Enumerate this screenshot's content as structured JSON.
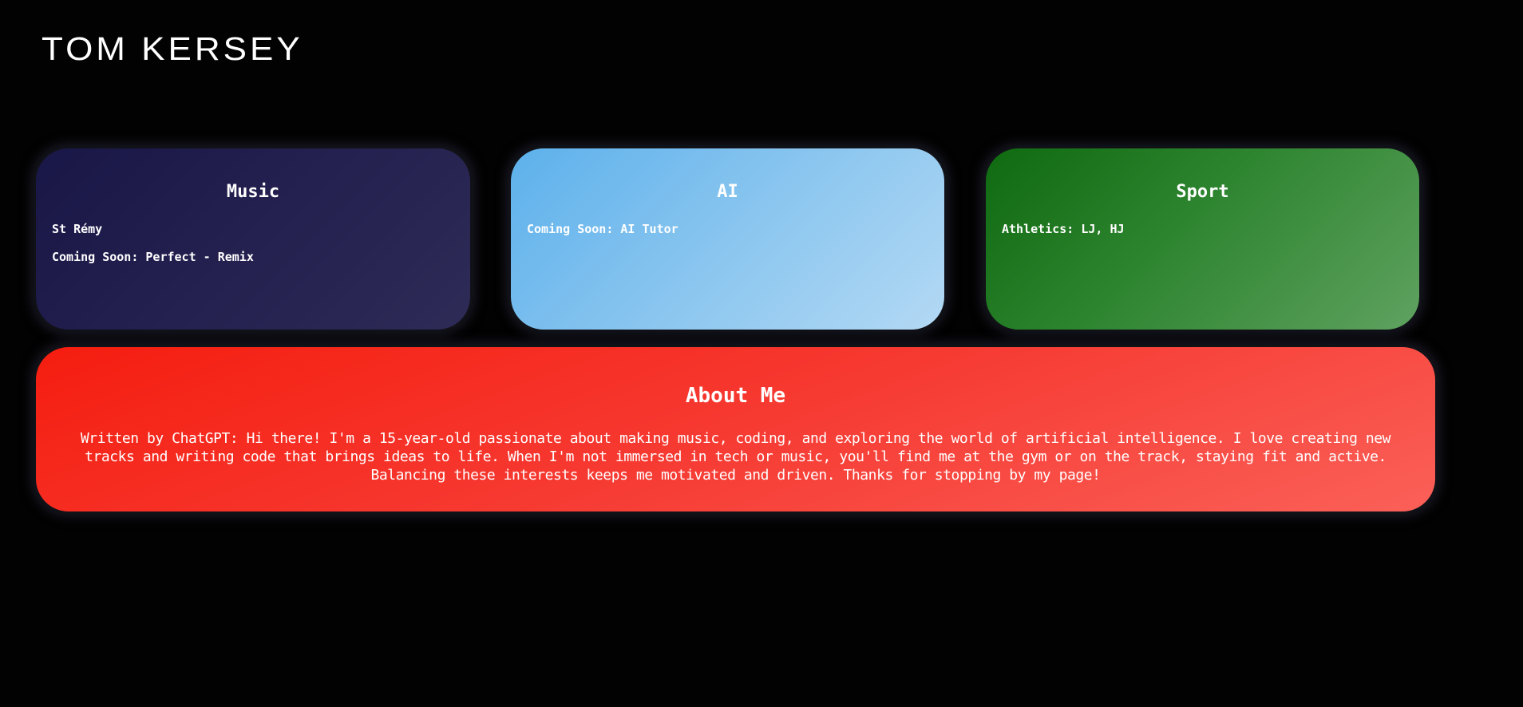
{
  "header": {
    "logo_text": "TOM KERSEY"
  },
  "cards": [
    {
      "title": "Music",
      "items": [
        "St Rémy",
        "Coming Soon: Perfect - Remix"
      ]
    },
    {
      "title": "AI",
      "items": [
        "Coming Soon: AI Tutor"
      ]
    },
    {
      "title": "Sport",
      "items": [
        "Athletics: LJ, HJ"
      ]
    }
  ],
  "about": {
    "title": "About Me",
    "body": "Written by ChatGPT: Hi there! I'm a 15-year-old passionate about making music, coding, and exploring the world of artificial intelligence. I love creating new tracks and writing code that brings ideas to life. When I'm not immersed in tech or music, you'll find me at the gym or on the track, staying fit and active. Balancing these interests keeps me motivated and driven. Thanks for stopping by my page!"
  },
  "colors": {
    "background": "#020202",
    "music_card": "#1f1c4b",
    "ai_card": "#7fc0ee",
    "sport_card": "#2a8a2c",
    "about_card": "#f6352b",
    "text": "#ffffff"
  }
}
